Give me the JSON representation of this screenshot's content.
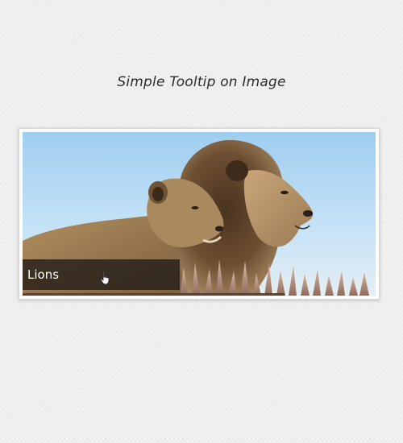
{
  "header": {
    "title": "Simple Tooltip on Image"
  },
  "image": {
    "subject": "lions-photo",
    "tooltip_label": "Lions",
    "tooltip_color": "#261e18",
    "sky_color": "#b9dcf4"
  }
}
